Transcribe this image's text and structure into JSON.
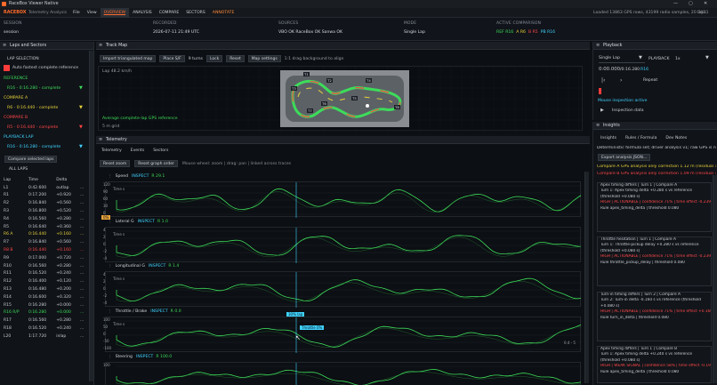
{
  "window": {
    "title": "RaceBox Viewer Native",
    "controls": [
      "—",
      "▢",
      "✕"
    ]
  },
  "menu": {
    "app_name": "RACEBOX",
    "app_subtitle": "Telemetry Analysis",
    "items": [
      "File",
      "View",
      "OVERVIEW",
      "ANALYSIS",
      "COMPARE",
      "SECTORS",
      "ANNOTATE"
    ],
    "status_loaded": "Loaded 13863 GPS rows, 43199 radio samples, 20 laps",
    "status_delta": "DX11"
  },
  "info": {
    "session_label": "SESSION",
    "session_value": "session",
    "recorded_label": "RECORDED",
    "recorded_value": "2026-07-11 21:49 UTC",
    "sources_label": "SOURCES",
    "sources_value": "VBO OK  RaceBox OK  Sanwa OK",
    "mode_label": "MODE",
    "mode_value": "Single Lap",
    "comparison_label": "ACTIVE COMPARISON",
    "comparison_ref": "REF R16",
    "comparison_a": "A R6",
    "comparison_b": "B R5",
    "comparison_pb": "PB R16"
  },
  "laps_panel": {
    "title": "Laps and Sectors",
    "lap_selection": "LAP SELECTION",
    "auto_fastest": "Auto fastest complete reference",
    "reference_label": "REFERENCE",
    "reference_value": "R16 - 0:16.280 - complete",
    "compare_a_label": "COMPARE A",
    "compare_a_value": "R6 - 0:16.440 - complete",
    "compare_b_label": "COMPARE B",
    "compare_b_value": "R5 - 0:16.440 - complete",
    "playback_label": "PLAYBACK LAP",
    "playback_value": "R16 - 0:16.280 - complete",
    "compare_selected_btn": "Compare selected laps",
    "all_laps": "ALL LAPS",
    "columns": [
      "Lap",
      "Time",
      "Delta"
    ],
    "rows": [
      {
        "lap": "L1",
        "time": "0:42.600",
        "delta": "outlap"
      },
      {
        "lap": "R1",
        "time": "0:17.200",
        "delta": "+0.920"
      },
      {
        "lap": "R2",
        "time": "0:16.840",
        "delta": "+0.560"
      },
      {
        "lap": "R3",
        "time": "0:16.800",
        "delta": "+0.520"
      },
      {
        "lap": "R4",
        "time": "0:16.560",
        "delta": "+0.280"
      },
      {
        "lap": "R5",
        "time": "0:16.640",
        "delta": "+0.360"
      },
      {
        "lap": "R6 A",
        "time": "0:16.440",
        "delta": "+0.160"
      },
      {
        "lap": "R7",
        "time": "0:16.840",
        "delta": "+0.560"
      },
      {
        "lap": "R8 B",
        "time": "0:16.440",
        "delta": "+0.160"
      },
      {
        "lap": "R9",
        "time": "0:17.000",
        "delta": "+0.720"
      },
      {
        "lap": "R10",
        "time": "0:16.560",
        "delta": "+0.280"
      },
      {
        "lap": "R11",
        "time": "0:16.520",
        "delta": "+0.240"
      },
      {
        "lap": "R12",
        "time": "0:16.400",
        "delta": "+0.120"
      },
      {
        "lap": "R13",
        "time": "0:16.480",
        "delta": "+0.200"
      },
      {
        "lap": "R14",
        "time": "0:16.600",
        "delta": "+0.320"
      },
      {
        "lap": "R15",
        "time": "0:16.280",
        "delta": "+0.000"
      },
      {
        "lap": "R16 R/P",
        "time": "0:16.280",
        "delta": "+0.000"
      },
      {
        "lap": "R17",
        "time": "0:16.560",
        "delta": "+0.280"
      },
      {
        "lap": "R18",
        "time": "0:16.520",
        "delta": "+0.240"
      },
      {
        "lap": "L20",
        "time": "1:17.720",
        "delta": "inlap"
      }
    ]
  },
  "track_map": {
    "title": "Track Map",
    "btn_import": "Import triangulated map",
    "btn_place": "Place S/F",
    "turns": "9 turns",
    "btn_lock": "Lock",
    "btn_reset": "Reset",
    "btn_settings": "Map settings",
    "hint": "1:1   drag background to align",
    "lap_speed": "Lap  48.2 km/h",
    "avg_note": "Average complete-lap GPS reference",
    "grid": "5 m grid",
    "turn_labels": [
      "T1",
      "T2",
      "T3",
      "T4",
      "T5",
      "T6",
      "T7",
      "T8",
      "T9"
    ]
  },
  "telemetry": {
    "title": "Telemetry",
    "tabs": [
      "Telemetry",
      "Events",
      "Sectors"
    ],
    "btn_reset_zoom": "Reset zoom",
    "btn_reset_order": "Reset graph order",
    "hint": "Mouse wheel: zoom  |  drag: pan  |  linked across traces",
    "inspect": "INSPECT",
    "channels": [
      {
        "name": "Speed",
        "value": "R 29.1",
        "yticks": [
          "120",
          "90",
          "60",
          "30",
          "0"
        ],
        "xlabel": "Time s"
      },
      {
        "name": "Lateral G",
        "value": "R 1.0",
        "yticks": [
          "4",
          "2",
          "0",
          "-2",
          "-4"
        ],
        "xlabel": "Time s"
      },
      {
        "name": "Longitudinal G",
        "value": "R 1.4",
        "yticks": [
          "4",
          "2",
          "0",
          "-2",
          "-4"
        ],
        "xlabel": "Time s"
      },
      {
        "name": "Throttle / Brake",
        "value": "R 0.0",
        "yticks": [
          "100",
          "50",
          "0",
          "-50",
          "-100"
        ],
        "xlabel": "Time s"
      },
      {
        "name": "Steering",
        "value": "R 100.0",
        "yticks": [
          "100"
        ],
        "xlabel": ""
      }
    ],
    "tooltip_zero": "0%",
    "tooltip_cursor": "30% lap",
    "tooltip_throttle": "Throttle 0%",
    "axis_range": "0.4 - 5"
  },
  "playback": {
    "title": "Playback",
    "mode": "Single Lap",
    "playback_label": "PLAYBACK",
    "speed": "1x",
    "time": "0:00.000",
    "lap_time": "/0:16.280",
    "lap": "R16",
    "repeat": "Repeat",
    "mouse_inspection": "Mouse inspection active",
    "inspection_data": "Inspection data"
  },
  "insights": {
    "title": "Insights",
    "tabs": [
      "Insights",
      "Rules / Formula",
      "Dev Notes"
    ],
    "deterministic": "Deterministic formula set; driver analysis v1; raw GPS is never r",
    "btn_export": "Export analysis JSON...",
    "compare_a_note": "Compare A GPS analysis only correction 1.12 m (residual 1.33 m",
    "compare_b_note": "Compare B GPS analysis only correction 1.09 m (residual 1.26 m",
    "cards": [
      {
        "head": "Apex timing differs | Turn 1 | Compare A",
        "lines": [
          "Turn 1: Apex timing delta +0.280 s vs reference",
          "(threshold +0.080 s)"
        ],
        "flag": "HIGH | ACTIONABLE | confidence 71% | time effect -0.239",
        "rule": "Rule apex_timing_delta | threshold 0.080"
      },
      {
        "head": "Throttle hesitation | Turn 1 | Compare A",
        "lines": [
          "Turn 1: Throttle-pickup delay +0.280 s vs reference",
          "(threshold +0.080 s)"
        ],
        "flag": "HIGH | ACTIONABLE | confidence 71% | time effect -0.239",
        "rule": "Rule throttle_pickup_delay | threshold 0.080"
      },
      {
        "head": "Turn-in timing differs | Turn 2 | Compare A",
        "lines": [
          "Turn 2: Turn-in delta -0.160 s vs reference (threshold",
          "+0.080 s)"
        ],
        "flag": "HIGH | ACTIONABLE | confidence 71% | time effect +0.160",
        "rule": "Rule turn_in_delta | threshold 0.080"
      },
      {
        "head": "Apex timing differs | Turn 1 | Compare B",
        "lines": [
          "Turn 1: Apex timing delta +0.240 s vs reference",
          "(threshold +0.080 s)"
        ],
        "flag": "HIGH | WEAK SIGNAL | confidence 58% | time effect -0.197",
        "rule": "Rule apex_timing_delta | threshold 0.080"
      }
    ]
  },
  "colors": {
    "accent": "#ff6b2b",
    "green": "#3ddc5a",
    "cyan": "#3fd3ff",
    "red": "#ff4646",
    "yellow": "#e7d23a"
  }
}
